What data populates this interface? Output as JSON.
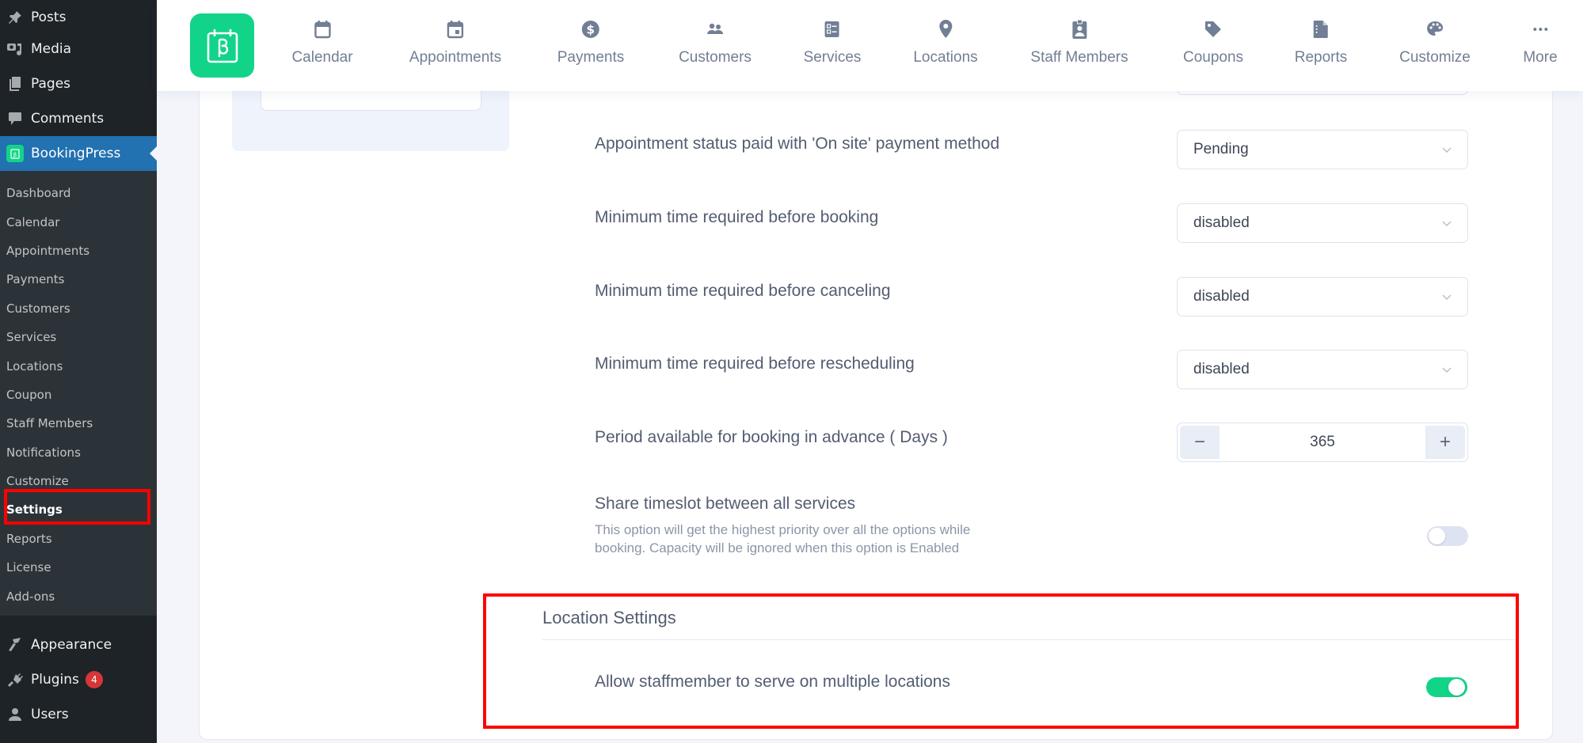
{
  "wp_sidebar": {
    "top_items": [
      {
        "label": "Posts",
        "icon": "pushpin-icon"
      },
      {
        "label": "Media",
        "icon": "media-icon"
      },
      {
        "label": "Pages",
        "icon": "pages-icon"
      },
      {
        "label": "Comments",
        "icon": "comment-icon"
      },
      {
        "label": "BookingPress",
        "icon": "bookingpress-icon",
        "active": true
      }
    ],
    "submenu": [
      "Dashboard",
      "Calendar",
      "Appointments",
      "Payments",
      "Customers",
      "Services",
      "Locations",
      "Coupon",
      "Staff Members",
      "Notifications",
      "Customize",
      "Settings",
      "Reports",
      "License",
      "Add-ons"
    ],
    "current_submenu": "Settings",
    "bottom_items": [
      {
        "label": "Appearance",
        "icon": "paintbrush-icon"
      },
      {
        "label": "Plugins",
        "icon": "plugin-icon",
        "badge": "4"
      },
      {
        "label": "Users",
        "icon": "user-icon"
      }
    ]
  },
  "header_nav": {
    "items": [
      {
        "label": "Calendar",
        "icon": "calendar-icon"
      },
      {
        "label": "Appointments",
        "icon": "calendar-event-icon"
      },
      {
        "label": "Payments",
        "icon": "dollar-circle-icon"
      },
      {
        "label": "Customers",
        "icon": "users-icon"
      },
      {
        "label": "Services",
        "icon": "services-list-icon"
      },
      {
        "label": "Locations",
        "icon": "map-pin-icon"
      },
      {
        "label": "Staff Members",
        "icon": "id-badge-icon"
      },
      {
        "label": "Coupons",
        "icon": "tag-icon"
      },
      {
        "label": "Reports",
        "icon": "report-file-icon"
      },
      {
        "label": "Customize",
        "icon": "palette-icon"
      },
      {
        "label": "More",
        "icon": "more-dots-icon"
      }
    ]
  },
  "settings": {
    "rows": [
      {
        "label": "Appointment status paid with 'On site' payment method",
        "type": "select",
        "value": "Pending"
      },
      {
        "label": "Minimum time required before booking",
        "type": "select",
        "value": "disabled"
      },
      {
        "label": "Minimum time required before canceling",
        "type": "select",
        "value": "disabled"
      },
      {
        "label": "Minimum time required before rescheduling",
        "type": "select",
        "value": "disabled"
      },
      {
        "label": "Period available for booking in advance ( Days )",
        "type": "stepper",
        "value": "365",
        "minus": "−",
        "plus": "+"
      },
      {
        "label": "Share timeslot between all services",
        "type": "toggle",
        "value": false,
        "description": "This option will get the highest priority over all the options while booking. Capacity will be ignored when this option is Enabled"
      }
    ],
    "location_section": {
      "title": "Location Settings",
      "rows": [
        {
          "label": "Allow staffmember to serve on multiple locations",
          "type": "toggle",
          "value": true
        }
      ]
    }
  },
  "colors": {
    "brand_green": "#12d488",
    "wp_active_blue": "#2271b1",
    "highlight_red": "#ff0000",
    "badge_red": "#d63638"
  }
}
